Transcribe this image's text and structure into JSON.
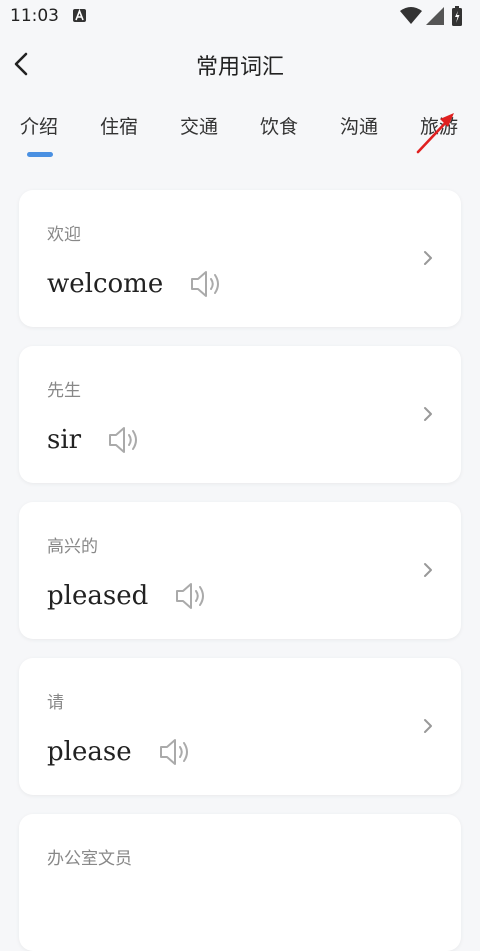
{
  "status_bar": {
    "time": "11:03"
  },
  "header": {
    "title": "常用词汇"
  },
  "tabs": [
    {
      "label": "介绍",
      "selected": true
    },
    {
      "label": "住宿",
      "selected": false
    },
    {
      "label": "交通",
      "selected": false
    },
    {
      "label": "饮食",
      "selected": false
    },
    {
      "label": "沟通",
      "selected": false
    },
    {
      "label": "旅游",
      "selected": false
    }
  ],
  "words": [
    {
      "cn": "欢迎",
      "en": "welcome"
    },
    {
      "cn": "先生",
      "en": "sir"
    },
    {
      "cn": "高兴的",
      "en": "pleased"
    },
    {
      "cn": "请",
      "en": "please"
    },
    {
      "cn": "办公室文员",
      "en": ""
    }
  ],
  "colors": {
    "accent": "#4a90e2",
    "annotation": "#e02020",
    "background": "#f6f7f9"
  },
  "icons": [
    "back-arrow-icon",
    "speaker-icon",
    "chevron-right-icon",
    "wifi-icon",
    "signal-icon",
    "battery-icon"
  ]
}
